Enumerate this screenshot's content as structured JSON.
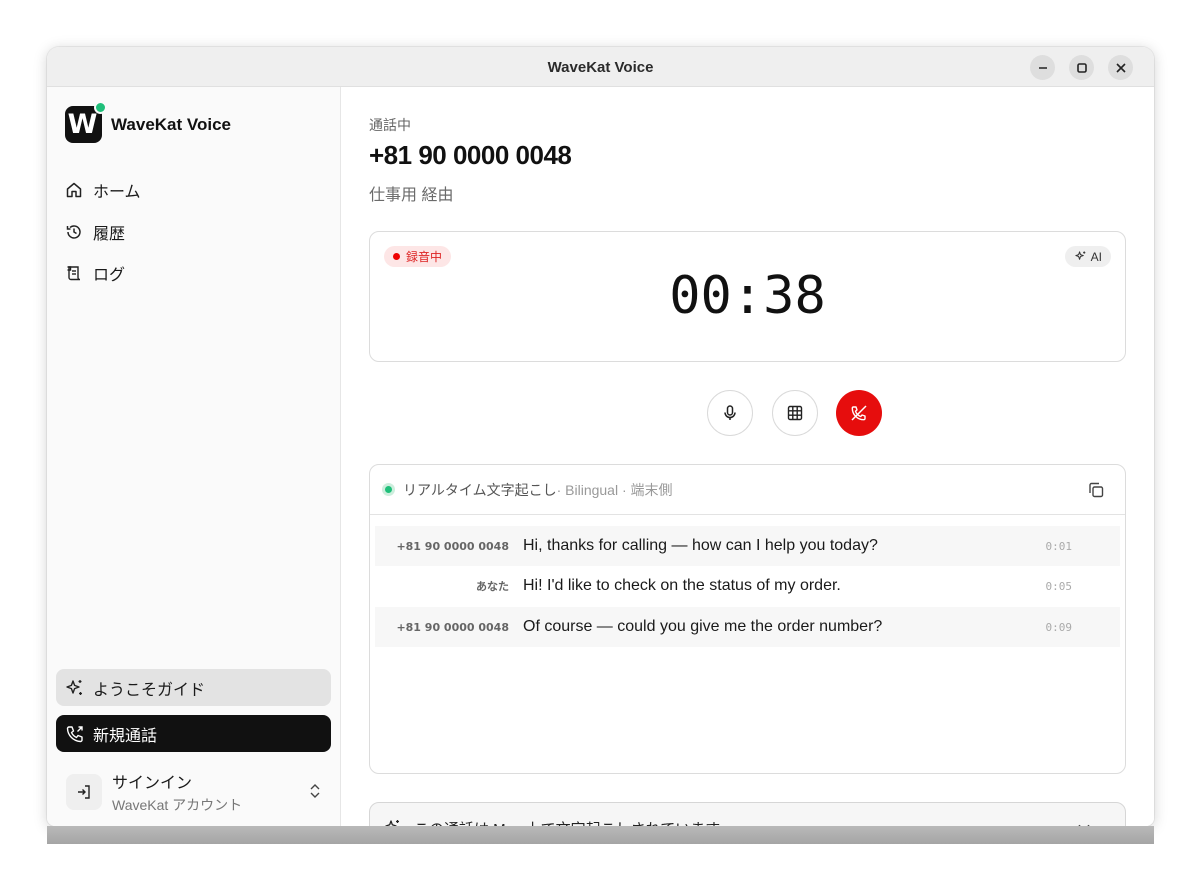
{
  "window": {
    "title": "WaveKat Voice"
  },
  "sidebar": {
    "brand_name": "WaveKat Voice",
    "logo_letter": "W",
    "items": [
      {
        "label": "ホーム",
        "icon": "home-icon"
      },
      {
        "label": "履歴",
        "icon": "history-icon"
      },
      {
        "label": "ログ",
        "icon": "log-icon"
      }
    ],
    "guide_label": "ようこそガイド",
    "new_call_label": "新規通話",
    "account": {
      "title": "サインイン",
      "subtitle": "WaveKat アカウント"
    }
  },
  "call": {
    "status": "通話中",
    "number": "+81 90 0000 0048",
    "via": "仕事用 経由",
    "recording_label": "録音中",
    "ai_label": "AI",
    "timer": "00:38"
  },
  "transcript": {
    "title": "リアルタイム文字起こし",
    "meta": " · Bilingual · 端末側",
    "rows": [
      {
        "speaker": "+81 90 0000 0048",
        "text": "Hi, thanks for calling — how can I help you today?",
        "time": "0:01"
      },
      {
        "speaker": "あなた",
        "text": "Hi! I'd like to check on the status of my order.",
        "time": "0:05"
      },
      {
        "speaker": "+81 90 0000 0048",
        "text": "Of course — could you give me the order number?",
        "time": "0:09"
      }
    ]
  },
  "footer_notice": "この通話は Mac 上で文字起こしされています",
  "colors": {
    "accent_green": "#1fbf7a",
    "hangup_red": "#e60d0d",
    "record_red": "#dd2222"
  }
}
